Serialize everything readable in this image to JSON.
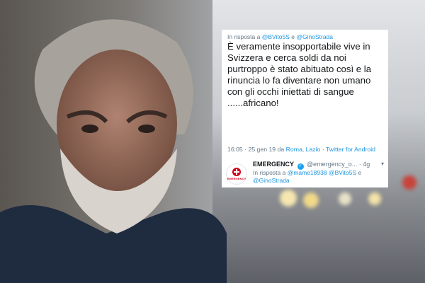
{
  "tweet": {
    "reply_prefix": "In risposta a",
    "reply_user1": "@BVito5S",
    "reply_and": "e",
    "reply_user2": "@GinoStrada",
    "text": "È veramente insopportabile vive in Svizzera e cerca soldi da noi purtroppo è stato abituato così e la rinuncia lo fa diventare non umano con gli occhi iniettati di sangue ......africano!",
    "time": "16:05 · 25 gen 19 da",
    "location": "Roma, Lazio",
    "separator": "·",
    "client": "Twitter for Android",
    "icons": [
      "reply-icon",
      "retweet-icon",
      "like-icon",
      "share-icon"
    ]
  },
  "reply_tweet": {
    "name": "EMERGENCY",
    "handle": "@emergency_o...",
    "age": "· 4g",
    "reply_prefix": "In risposta a",
    "reply_user1": "@mame18938",
    "reply_user2": "@BVito5S",
    "reply_and": "e",
    "reply_user3": "@GinoStrada",
    "avatar_text": "EMERGENCY"
  },
  "colors": {
    "link": "#1b95e0",
    "muted": "#657786",
    "text": "#14171a",
    "brand_red": "#d0021b"
  }
}
